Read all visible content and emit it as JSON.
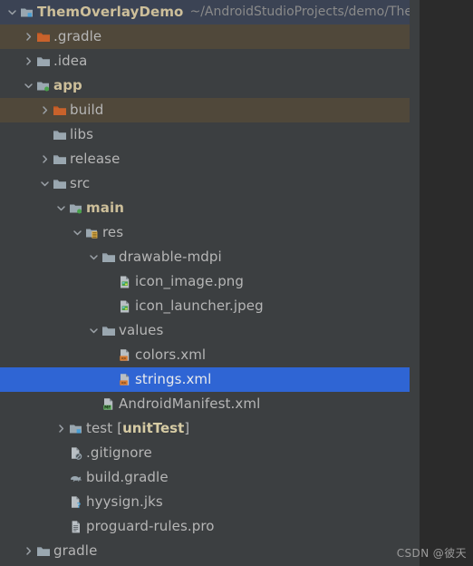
{
  "panel": {
    "name": "project-tool-window",
    "background": "#3c3f41",
    "selection_color": "#2f65d4",
    "modified_row_color": "#50483a",
    "inactive_selection_color": "#3b4354"
  },
  "project": {
    "name": "ThemOverlayDemo",
    "path": "~/AndroidStudioProjects/demo/ThemO"
  },
  "watermark": "CSDN @彼天",
  "tree": {
    "rows": [
      {
        "label": "ThemOverlayDemo",
        "suffix": "",
        "path": "~/AndroidStudioProjects/demo/ThemO",
        "depth": 0,
        "arrow": "down",
        "icon": "module-folder-icon",
        "style": "bold",
        "state": "rootsel"
      },
      {
        "label": ".gradle",
        "suffix": "",
        "path": "",
        "depth": 1,
        "arrow": "right",
        "icon": "orange-folder-icon",
        "style": "plain",
        "state": "modified"
      },
      {
        "label": ".idea",
        "suffix": "",
        "path": "",
        "depth": 1,
        "arrow": "right",
        "icon": "folder-icon",
        "style": "plain",
        "state": "none"
      },
      {
        "label": "app",
        "suffix": "",
        "path": "",
        "depth": 1,
        "arrow": "down",
        "icon": "module-green-folder-icon",
        "style": "bold",
        "state": "none"
      },
      {
        "label": "build",
        "suffix": "",
        "path": "",
        "depth": 2,
        "arrow": "right",
        "icon": "orange-folder-icon",
        "style": "plain",
        "state": "modified"
      },
      {
        "label": "libs",
        "suffix": "",
        "path": "",
        "depth": 2,
        "arrow": "none",
        "icon": "folder-icon",
        "style": "plain",
        "state": "none"
      },
      {
        "label": "release",
        "suffix": "",
        "path": "",
        "depth": 2,
        "arrow": "right",
        "icon": "folder-icon",
        "style": "plain",
        "state": "none"
      },
      {
        "label": "src",
        "suffix": "",
        "path": "",
        "depth": 2,
        "arrow": "down",
        "icon": "folder-icon",
        "style": "plain",
        "state": "none"
      },
      {
        "label": "main",
        "suffix": "",
        "path": "",
        "depth": 3,
        "arrow": "down",
        "icon": "module-green-folder-icon",
        "style": "bold",
        "state": "none"
      },
      {
        "label": "res",
        "suffix": "",
        "path": "",
        "depth": 4,
        "arrow": "down",
        "icon": "res-folder-icon",
        "style": "plain",
        "state": "none"
      },
      {
        "label": "drawable-mdpi",
        "suffix": "",
        "path": "",
        "depth": 5,
        "arrow": "down",
        "icon": "folder-icon",
        "style": "plain",
        "state": "none"
      },
      {
        "label": "icon_image.png",
        "suffix": "",
        "path": "",
        "depth": 6,
        "arrow": "none",
        "icon": "image-file-icon",
        "style": "plain",
        "state": "none"
      },
      {
        "label": "icon_launcher.jpeg",
        "suffix": "",
        "path": "",
        "depth": 6,
        "arrow": "none",
        "icon": "image-file-icon",
        "style": "plain",
        "state": "none"
      },
      {
        "label": "values",
        "suffix": "",
        "path": "",
        "depth": 5,
        "arrow": "down",
        "icon": "folder-icon",
        "style": "plain",
        "state": "none"
      },
      {
        "label": "colors.xml",
        "suffix": "",
        "path": "",
        "depth": 6,
        "arrow": "none",
        "icon": "xml-file-icon",
        "style": "plain",
        "state": "none"
      },
      {
        "label": "strings.xml",
        "suffix": "",
        "path": "",
        "depth": 6,
        "arrow": "none",
        "icon": "xml-file-icon",
        "style": "sel",
        "state": "selected"
      },
      {
        "label": "AndroidManifest.xml",
        "suffix": "",
        "path": "",
        "depth": 5,
        "arrow": "none",
        "icon": "manifest-file-icon",
        "style": "plain",
        "state": "none"
      },
      {
        "label": "test",
        "suffix": "[unitTest]",
        "path": "",
        "depth": 3,
        "arrow": "right",
        "icon": "test-module-folder-icon",
        "style": "plain",
        "state": "none"
      },
      {
        "label": ".gitignore",
        "suffix": "",
        "path": "",
        "depth": 3,
        "arrow": "none",
        "icon": "gitignore-file-icon",
        "style": "plain",
        "state": "none"
      },
      {
        "label": "build.gradle",
        "suffix": "",
        "path": "",
        "depth": 3,
        "arrow": "none",
        "icon": "gradle-elephant-icon",
        "style": "plain",
        "state": "none"
      },
      {
        "label": "hyysign.jks",
        "suffix": "",
        "path": "",
        "depth": 3,
        "arrow": "none",
        "icon": "unknown-file-icon",
        "style": "plain",
        "state": "none"
      },
      {
        "label": "proguard-rules.pro",
        "suffix": "",
        "path": "",
        "depth": 3,
        "arrow": "none",
        "icon": "text-file-icon",
        "style": "plain",
        "state": "none"
      },
      {
        "label": "gradle",
        "suffix": "",
        "path": "",
        "depth": 1,
        "arrow": "right",
        "icon": "folder-icon",
        "style": "plain",
        "state": "none"
      }
    ]
  }
}
